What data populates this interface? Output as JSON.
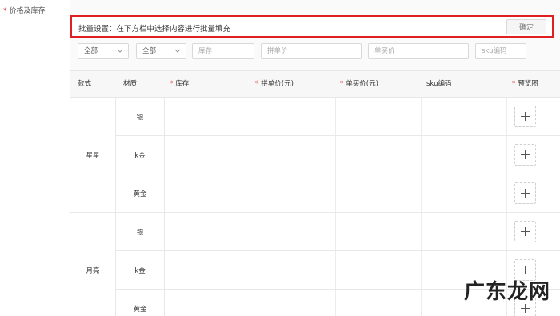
{
  "field": {
    "required_mark": "*",
    "label": "价格及库存"
  },
  "batch": {
    "label": "批量设置：在下方栏中选择内容进行批量填充",
    "confirm": "确定"
  },
  "filters": {
    "style_select": "全部",
    "material_select": "全部",
    "stock_placeholder": "库存",
    "group_price_placeholder": "拼单价",
    "single_price_placeholder": "单买价",
    "sku_placeholder": "sku编码"
  },
  "table": {
    "headers": {
      "style": "款式",
      "material": "材质",
      "stock": "库存",
      "group_price": "拼单价(元)",
      "single_price": "单买价(元)",
      "sku": "sku编码",
      "preview": "预览图"
    },
    "required_mark": "*",
    "groups": [
      {
        "style": "星星",
        "materials": [
          "银",
          "k金",
          "黄金"
        ]
      },
      {
        "style": "月亮",
        "materials": [
          "银",
          "k金",
          "黄金"
        ]
      }
    ]
  },
  "watermark": "广东龙网",
  "colors": {
    "required": "#e4393c",
    "highlight_border": "#e02020"
  },
  "icons": {
    "upload": "plus-icon",
    "select": "chevron-down-icon"
  }
}
